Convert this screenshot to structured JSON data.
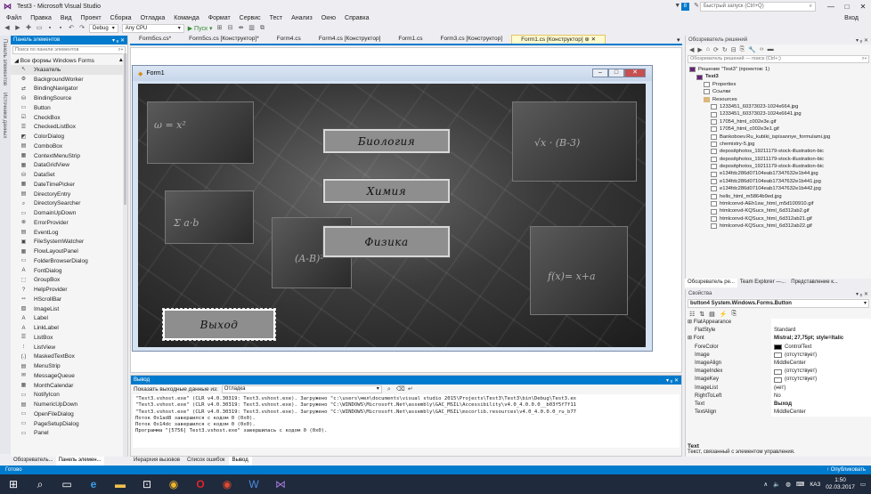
{
  "window": {
    "title": "Test3 - Microsoft Visual Studio",
    "flag_count": "8",
    "quick_launch_placeholder": "Быстрый запуск (Ctrl+Q)",
    "minimize": "—",
    "maximize": "□",
    "close": "✕"
  },
  "menu": {
    "items": [
      "Файл",
      "Правка",
      "Вид",
      "Проект",
      "Сборка",
      "Отладка",
      "Команда",
      "Формат",
      "Сервис",
      "Тест",
      "Анализ",
      "Окно",
      "Справка"
    ],
    "sign_in": "Вход"
  },
  "toolbar": {
    "config": "Debug",
    "platform": "Any CPU",
    "start": "▶ Пуск ▾"
  },
  "sidebar_tabs": [
    "Панель элементов",
    "Источники данных"
  ],
  "toolbox": {
    "title": "Панель элементов",
    "pin": "▾ ᵩ ✕",
    "search_placeholder": "Поиск по панели элементов",
    "group": "◢ Все формы Windows Forms",
    "items": [
      {
        "icon": "pointer-icon",
        "glyph": "↖",
        "label": "Указатель"
      },
      {
        "icon": "background-worker-icon",
        "glyph": "⚙",
        "label": "BackgroundWorker"
      },
      {
        "icon": "binding-navigator-icon",
        "glyph": "⇄",
        "label": "BindingNavigator"
      },
      {
        "icon": "binding-source-icon",
        "glyph": "⛁",
        "label": "BindingSource"
      },
      {
        "icon": "button-icon",
        "glyph": "▭",
        "label": "Button"
      },
      {
        "icon": "checkbox-icon",
        "glyph": "☑",
        "label": "CheckBox"
      },
      {
        "icon": "checked-listbox-icon",
        "glyph": "☰",
        "label": "CheckedListBox"
      },
      {
        "icon": "color-dialog-icon",
        "glyph": "◩",
        "label": "ColorDialog"
      },
      {
        "icon": "combobox-icon",
        "glyph": "▤",
        "label": "ComboBox"
      },
      {
        "icon": "context-menu-icon",
        "glyph": "▦",
        "label": "ContextMenuStrip"
      },
      {
        "icon": "datagridview-icon",
        "glyph": "▦",
        "label": "DataGridView"
      },
      {
        "icon": "dataset-icon",
        "glyph": "⛁",
        "label": "DataSet"
      },
      {
        "icon": "datetimepicker-icon",
        "glyph": "▦",
        "label": "DateTimePicker"
      },
      {
        "icon": "directory-entry-icon",
        "glyph": "▤",
        "label": "DirectoryEntry"
      },
      {
        "icon": "directory-searcher-icon",
        "glyph": "⌕",
        "label": "DirectorySearcher"
      },
      {
        "icon": "domain-updown-icon",
        "glyph": "▭",
        "label": "DomainUpDown"
      },
      {
        "icon": "error-provider-icon",
        "glyph": "⊗",
        "label": "ErrorProvider"
      },
      {
        "icon": "eventlog-icon",
        "glyph": "▤",
        "label": "EventLog"
      },
      {
        "icon": "filesystem-watcher-icon",
        "glyph": "▣",
        "label": "FileSystemWatcher"
      },
      {
        "icon": "flowlayout-panel-icon",
        "glyph": "▦",
        "label": "FlowLayoutPanel"
      },
      {
        "icon": "folder-browser-icon",
        "glyph": "▭",
        "label": "FolderBrowserDialog"
      },
      {
        "icon": "font-dialog-icon",
        "glyph": "A",
        "label": "FontDialog"
      },
      {
        "icon": "groupbox-icon",
        "glyph": "⬚",
        "label": "GroupBox"
      },
      {
        "icon": "help-provider-icon",
        "glyph": "?",
        "label": "HelpProvider"
      },
      {
        "icon": "hscrollbar-icon",
        "glyph": "⇿",
        "label": "HScrollBar"
      },
      {
        "icon": "imagelist-icon",
        "glyph": "▨",
        "label": "ImageList"
      },
      {
        "icon": "label-icon",
        "glyph": "A",
        "label": "Label"
      },
      {
        "icon": "linklabel-icon",
        "glyph": "A",
        "label": "LinkLabel"
      },
      {
        "icon": "listbox-icon",
        "glyph": "☰",
        "label": "ListBox"
      },
      {
        "icon": "listview-icon",
        "glyph": "⁝",
        "label": "ListView"
      },
      {
        "icon": "masked-textbox-icon",
        "glyph": "(.)",
        "label": "MaskedTextBox"
      },
      {
        "icon": "menustrip-icon",
        "glyph": "▤",
        "label": "MenuStrip"
      },
      {
        "icon": "message-queue-icon",
        "glyph": "✉",
        "label": "MessageQueue"
      },
      {
        "icon": "month-calendar-icon",
        "glyph": "▦",
        "label": "MonthCalendar"
      },
      {
        "icon": "notifyicon-icon",
        "glyph": "▭",
        "label": "NotifyIcon"
      },
      {
        "icon": "numeric-updown-icon",
        "glyph": "▤",
        "label": "NumericUpDown"
      },
      {
        "icon": "open-file-dialog-icon",
        "glyph": "▭",
        "label": "OpenFileDialog"
      },
      {
        "icon": "page-setup-dialog-icon",
        "glyph": "▭",
        "label": "PageSetupDialog"
      },
      {
        "icon": "panel-icon",
        "glyph": "▭",
        "label": "Panel"
      }
    ],
    "tabs": [
      "Обозреватель...",
      "Панель элемен..."
    ]
  },
  "doc_tabs": [
    {
      "label": "Form5cs.cs*",
      "active": false
    },
    {
      "label": "Form5cs.cs [Конструктор]*",
      "active": false
    },
    {
      "label": "Form4.cs",
      "active": false
    },
    {
      "label": "Form4.cs [Конструктор]",
      "active": false
    },
    {
      "label": "Form1.cs",
      "active": false
    },
    {
      "label": "Form3.cs [Конструктор]",
      "active": false
    },
    {
      "label": "Form1.cs [Конструктор]  ⊕ ✕",
      "active": true
    }
  ],
  "form": {
    "title": "Form1",
    "buttons": [
      {
        "name": "biology-button",
        "label": "Биология"
      },
      {
        "name": "chemistry-button",
        "label": "Химия"
      },
      {
        "name": "physics-button",
        "label": "Физика"
      },
      {
        "name": "exit-button",
        "label": "Выход"
      }
    ]
  },
  "output": {
    "title": "Вывод",
    "show_from_label": "Показать выходные данные из:",
    "show_from_value": "Отладка",
    "lines": [
      "\"Test3.vshost.exe\" (CLR v4.0.30319: Test3.vshost.exe). Загружено \"c:\\users\\мел\\documents\\visual studio 2015\\Projects\\Test3\\Test3\\bin\\Debug\\Test3.ex",
      "\"Test3.vshost.exe\" (CLR v4.0.30319: Test3.vshost.exe). Загружено \"C:\\WINDOWS\\Microsoft.Net\\assembly\\GAC_MSIL\\Accessibility\\v4.0_4.0.0.0__b03f5f7f11",
      "\"Test3.vshost.exe\" (CLR v4.0.30319: Test3.vshost.exe). Загружено \"C:\\WINDOWS\\Microsoft.Net\\assembly\\GAC_MSIL\\mscorlib.resources\\v4.0_4.0.0.0_ru_b77",
      "Поток 0x1ad8 завершился с кодом 0 (0x0).",
      "Поток 0x14dc завершился с кодом 0 (0x0).",
      "Программа \"[5756] Test3.vshost.exe\" завершилась с кодом 0 (0x0)."
    ],
    "tabs": [
      "Иерархия вызовов",
      "Список ошибок",
      "Вывод"
    ]
  },
  "solution_explorer": {
    "title": "Обозреватель решений",
    "search_placeholder": "Обозреватель решений — поиск (Ctrl+;)",
    "items": [
      {
        "indent": 0,
        "kind": "solution",
        "label": "Решение \"Test3\" (проектов: 1)"
      },
      {
        "indent": 1,
        "kind": "project",
        "label": "Test3"
      },
      {
        "indent": 2,
        "kind": "node",
        "label": "Properties"
      },
      {
        "indent": 2,
        "kind": "node",
        "label": "Ссылки"
      },
      {
        "indent": 2,
        "kind": "folder",
        "label": "Resources"
      },
      {
        "indent": 3,
        "kind": "file",
        "label": "1233451_60373023-1024x664.jpg"
      },
      {
        "indent": 3,
        "kind": "file",
        "label": "1233451_60373023-1024x6641.jpg"
      },
      {
        "indent": 3,
        "kind": "file",
        "label": "17054_html_c002e3e.gif"
      },
      {
        "indent": 3,
        "kind": "file",
        "label": "17054_html_c002e3e1.gif"
      },
      {
        "indent": 3,
        "kind": "file",
        "label": "Bankoboev.Ru_kubiki_ispisannye_formulami.jpg"
      },
      {
        "indent": 3,
        "kind": "file",
        "label": "chemistry-5.jpg"
      },
      {
        "indent": 3,
        "kind": "file",
        "label": "depositphotos_19211179-stock-illustration-bic"
      },
      {
        "indent": 3,
        "kind": "file",
        "label": "depositphotos_19211179-stock-illustration-bic"
      },
      {
        "indent": 3,
        "kind": "file",
        "label": "depositphotos_19211179-stock-illustration-bic"
      },
      {
        "indent": 3,
        "kind": "file",
        "label": "e134fdc286d07104eab17347632e1b44.jpg"
      },
      {
        "indent": 3,
        "kind": "file",
        "label": "e134fdc286d07104eab17347632e1b441.jpg"
      },
      {
        "indent": 3,
        "kind": "file",
        "label": "e134fdc286d07104eab17347632e1b442.jpg"
      },
      {
        "indent": 3,
        "kind": "file",
        "label": "hello_html_m5864b9ed.jpg"
      },
      {
        "indent": 3,
        "kind": "file",
        "label": "htmlconvd-AEh1sw_html_m5d100910.gif"
      },
      {
        "indent": 3,
        "kind": "file",
        "label": "htmlconvd-KQSucx_html_6d312ab2.gif"
      },
      {
        "indent": 3,
        "kind": "file",
        "label": "htmlconvd-KQSucx_html_6d312ab21.gif"
      },
      {
        "indent": 3,
        "kind": "file",
        "label": "htmlconvd-KQSucx_html_6d312ab22.gif"
      }
    ],
    "tabs": [
      "Обозреватель ре...",
      "Team Explorer —...",
      "Представление к..."
    ]
  },
  "properties": {
    "title": "Свойства",
    "object": "button4 System.Windows.Forms.Button",
    "rows": [
      {
        "cat": true,
        "key": "⊞ FlatAppearance",
        "value": ""
      },
      {
        "cat": false,
        "key": "FlatStyle",
        "value": "Standard",
        "swatch": ""
      },
      {
        "cat": true,
        "key": "⊞ Font",
        "value": "Mistral; 27,75pt; style=Italic",
        "bold": true,
        "swatch": ""
      },
      {
        "cat": false,
        "key": "ForeColor",
        "value": "ControlText",
        "swatch": "#000000"
      },
      {
        "cat": false,
        "key": "Image",
        "value": "(отсутствует)",
        "swatch": "#ffffff"
      },
      {
        "cat": false,
        "key": "ImageAlign",
        "value": "MiddleCenter",
        "swatch": ""
      },
      {
        "cat": false,
        "key": "ImageIndex",
        "value": "(отсутствует)",
        "swatch": "#ffffff"
      },
      {
        "cat": false,
        "key": "ImageKey",
        "value": "(отсутствует)",
        "swatch": "#ffffff"
      },
      {
        "cat": false,
        "key": "ImageList",
        "value": "(нет)",
        "swatch": ""
      },
      {
        "cat": false,
        "key": "RightToLeft",
        "value": "No",
        "swatch": ""
      },
      {
        "cat": false,
        "key": "Text",
        "value": "Выход",
        "bold": true,
        "swatch": ""
      },
      {
        "cat": false,
        "key": "TextAlign",
        "value": "MiddleCenter",
        "swatch": ""
      }
    ],
    "desc_title": "Text",
    "desc_text": "Текст, связанный с элементом управления."
  },
  "status": {
    "left": "Готово",
    "right": "↑ Опубликовать"
  },
  "taskbar": {
    "lang": "КАЗ",
    "time": "1:50",
    "date": "02.03.2017"
  },
  "colors": {
    "accent": "#007acc",
    "taskbar": "#1f2a3c",
    "form_button_bg": "#8e8e8e"
  }
}
